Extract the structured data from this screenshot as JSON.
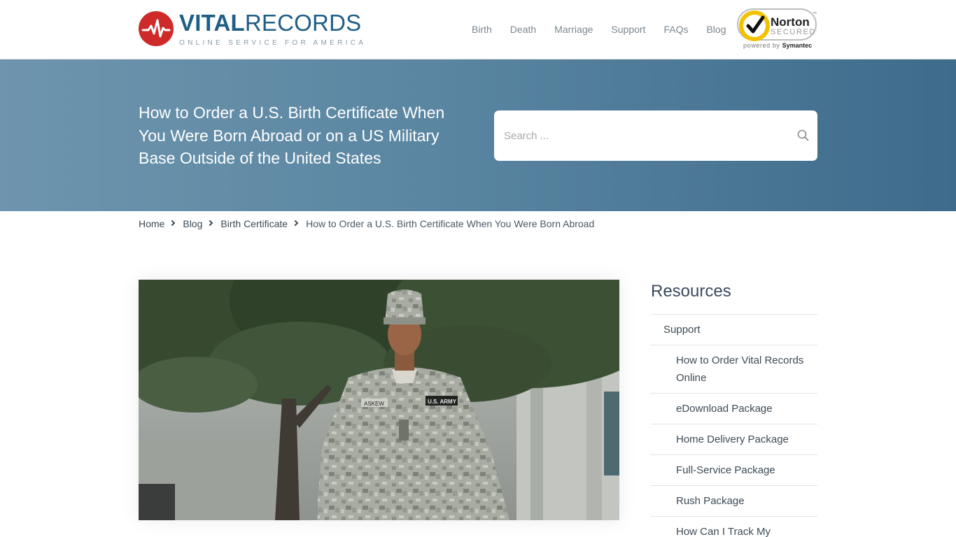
{
  "header": {
    "logo": {
      "title_bold": "VITAL",
      "title_light": "RECORDS",
      "tagline": "ONLINE SERVICE FOR AMERICA"
    },
    "nav": [
      "Birth",
      "Death",
      "Marriage",
      "Support",
      "FAQs",
      "Blog"
    ],
    "norton_badge": {
      "name": "Norton",
      "tm": "™",
      "secured": "SECURED",
      "powered_by": "powered by",
      "brand": "Symantec"
    }
  },
  "hero": {
    "title": "How to Order a U.S. Birth Certificate When You Were Born Abroad or on a US Military Base Outside of the United States",
    "search_placeholder": "Search ..."
  },
  "breadcrumb": {
    "items": [
      "Home",
      "Blog",
      "Birth Certificate"
    ],
    "current": "How to Order a U.S. Birth Certificate When You Were Born Abroad"
  },
  "article_image": {
    "icon": "photo of a soldier in camouflage uniform in front of a tree",
    "name_tape": "ASKEW",
    "branch_tape": "U.S. ARMY"
  },
  "sidebar": {
    "title": "Resources",
    "items": [
      {
        "label": "Support",
        "level": 1
      },
      {
        "label": "How to Order Vital Records Online",
        "level": 2
      },
      {
        "label": "eDownload Package",
        "level": 2
      },
      {
        "label": "Home Delivery Package",
        "level": 2
      },
      {
        "label": "Full-Service Package",
        "level": 2
      },
      {
        "label": "Rush Package",
        "level": 2
      },
      {
        "label": "How Can I Track My",
        "level": 2
      }
    ]
  },
  "colors": {
    "brand_blue": "#1f5e86",
    "brand_red": "#cf2a2a",
    "hero_gradient_start": "#6e95ad",
    "hero_gradient_end": "#3e6b8b",
    "norton_yellow": "#f2c200"
  }
}
